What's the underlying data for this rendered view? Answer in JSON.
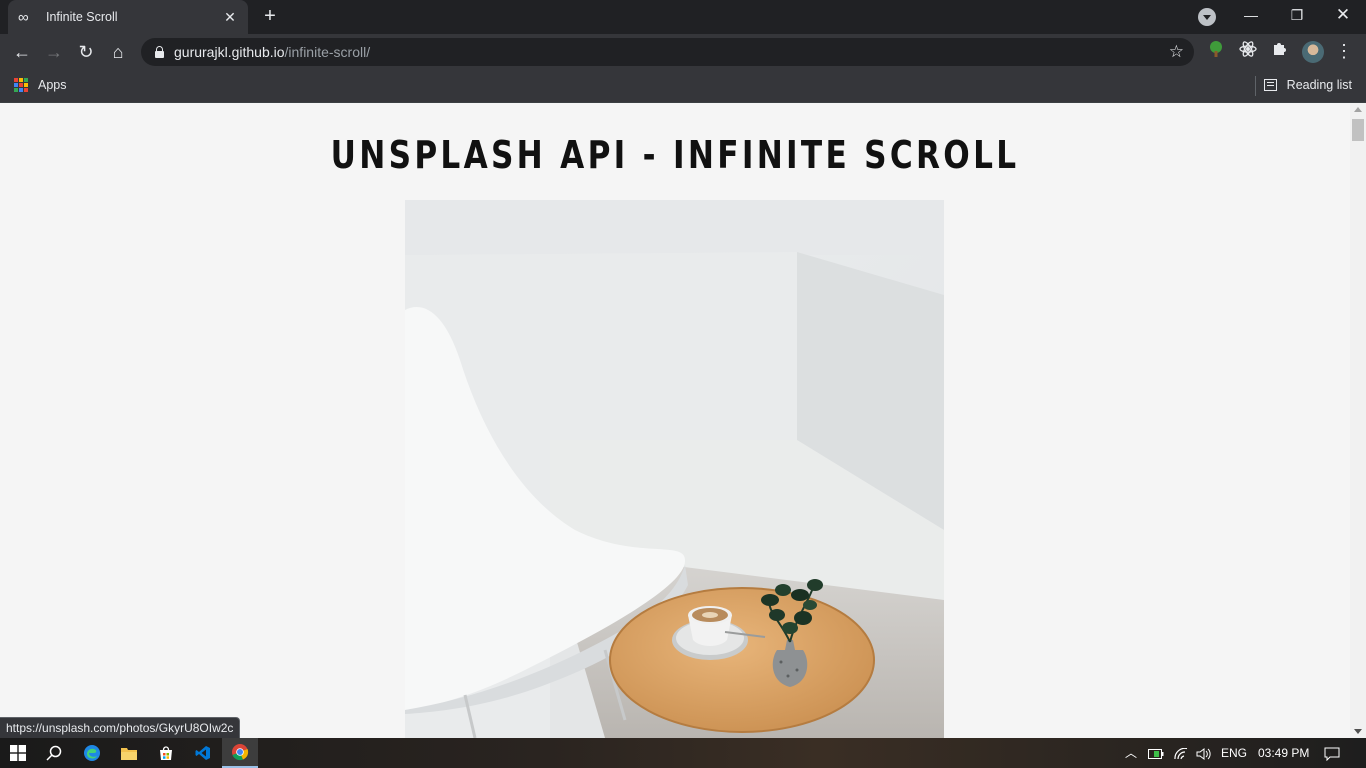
{
  "browser": {
    "tab": {
      "favicon": "∞",
      "title": "Infinite Scroll"
    },
    "url": {
      "host": "gururajkl.github.io",
      "path": "/infinite-scroll/"
    },
    "bookmarks": {
      "apps_label": "Apps",
      "reading_list_label": "Reading list"
    }
  },
  "page": {
    "title": "UNSPLASH API - INFINITE SCROLL",
    "status_url": "https://unsplash.com/photos/GkyrU8OIw2c"
  },
  "taskbar": {
    "language": "ENG",
    "time": "03:49 PM"
  },
  "colors": {
    "chrome_dark": "#202124",
    "chrome_toolbar": "#35363a",
    "page_bg": "#f5f5f5",
    "vscode_blue": "#0078d7",
    "explorer_yellow": "#f2c14e"
  }
}
